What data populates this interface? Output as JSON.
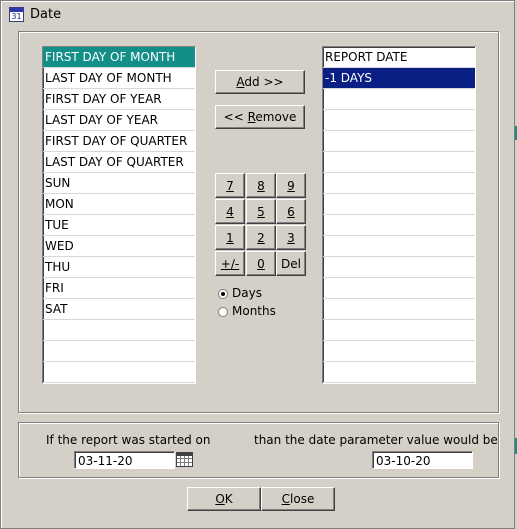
{
  "window": {
    "title": "Date",
    "icon": "date-dialog-icon"
  },
  "left_list": {
    "items": [
      "FIRST DAY OF MONTH",
      "LAST DAY OF MONTH",
      "FIRST DAY OF YEAR",
      "LAST DAY OF YEAR",
      "FIRST DAY OF QUARTER",
      "LAST DAY OF QUARTER",
      "SUN",
      "MON",
      "TUE",
      "WED",
      "THU",
      "FRI",
      "SAT"
    ],
    "selected_index": 0,
    "selected_color": "#138f8a"
  },
  "right_list": {
    "items": [
      "REPORT DATE",
      "-1 DAYS"
    ],
    "selected_index": 1,
    "selected_color": "#0a1f83"
  },
  "buttons": {
    "add": {
      "mnemonic": "A",
      "rest": "dd >>"
    },
    "remove": {
      "prefix": "<< ",
      "mnemonic": "R",
      "rest": "emove"
    },
    "ok": {
      "mnemonic": "O",
      "rest": "K"
    },
    "close": {
      "mnemonic": "C",
      "rest": "lose"
    }
  },
  "keypad": {
    "rows": [
      [
        "7",
        "8",
        "9"
      ],
      [
        "4",
        "5",
        "6"
      ],
      [
        "1",
        "2",
        "3"
      ],
      [
        "+/-",
        "0",
        "Del"
      ]
    ]
  },
  "unit_radio": {
    "options": [
      "Days",
      "Months"
    ],
    "selected_index": 0
  },
  "example": {
    "started_label": "If the report  was started on",
    "started_value": "03-11-20",
    "result_label": "than the date parameter  value would be",
    "result_value": "03-10-20"
  },
  "icons": {
    "calendar": "calendar-icon"
  }
}
